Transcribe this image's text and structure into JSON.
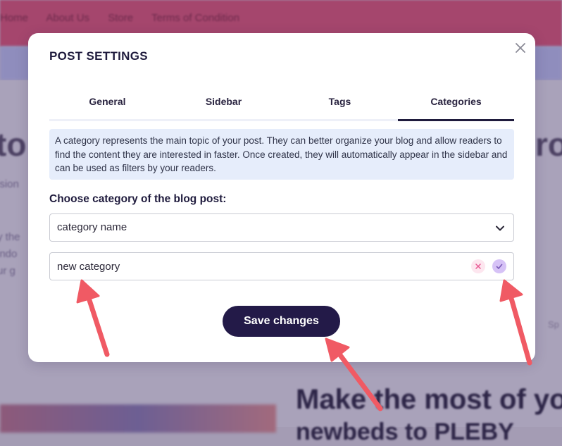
{
  "background": {
    "nav_items": [
      "Home",
      "About Us",
      "Store",
      "Terms of Condition"
    ],
    "title_fragment_left": "to",
    "title_fragment_right": "ro",
    "heading_fragment": "Make the most of yo",
    "heading_fragment_2": "newbeds to PLEBY",
    "colors": {
      "nav": "#a5466d",
      "overlay": "#a49cb4"
    }
  },
  "modal": {
    "title": "POST SETTINGS",
    "close_icon": "close-icon",
    "tabs": [
      {
        "label": "General",
        "active": false
      },
      {
        "label": "Sidebar",
        "active": false
      },
      {
        "label": "Tags",
        "active": false
      },
      {
        "label": "Categories",
        "active": true
      }
    ],
    "info_text": "A category represents the main topic of your post. They can better organize your blog and allow readers to find the content they are interested in faster. Once created, they will automatically appear in the sidebar and can be used as filters by your readers.",
    "category_label": "Choose category of the blog post:",
    "category_select": {
      "value": "category name",
      "icon": "chevron-down-icon"
    },
    "new_category_input": {
      "value": "new category",
      "placeholder": ""
    },
    "cancel_icon": "x-icon",
    "confirm_icon": "check-icon",
    "save_label": "Save changes",
    "colors": {
      "primary": "#231a48",
      "info_bg": "#e6edfb",
      "confirm": "#d6c2f6",
      "cancel": "#fde6ef",
      "annotation_arrow": "#f05a64"
    }
  }
}
